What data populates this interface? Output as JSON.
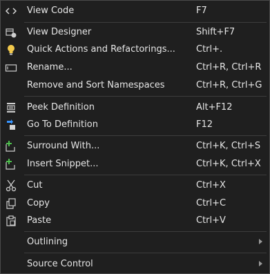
{
  "menu": {
    "view_code": {
      "label": "View Code",
      "shortcut": "F7",
      "icon": "code-icon"
    },
    "view_designer": {
      "label": "View Designer",
      "shortcut": "Shift+F7",
      "icon": "designer-icon"
    },
    "quick_actions": {
      "label": "Quick Actions and Refactorings...",
      "shortcut": "Ctrl+.",
      "icon": "lightbulb-icon"
    },
    "rename": {
      "label": "Rename...",
      "shortcut": "Ctrl+R, Ctrl+R",
      "icon": "rename-icon"
    },
    "remove_sort": {
      "label": "Remove and Sort Namespaces",
      "shortcut": "Ctrl+R, Ctrl+G"
    },
    "peek_definition": {
      "label": "Peek Definition",
      "shortcut": "Alt+F12",
      "icon": "peek-definition-icon"
    },
    "go_to_definition": {
      "label": "Go To Definition",
      "shortcut": "F12",
      "icon": "go-to-definition-icon"
    },
    "surround_with": {
      "label": "Surround With...",
      "shortcut": "Ctrl+K, Ctrl+S",
      "icon": "surround-with-icon"
    },
    "insert_snippet": {
      "label": "Insert Snippet...",
      "shortcut": "Ctrl+K, Ctrl+X",
      "icon": "insert-snippet-icon"
    },
    "cut": {
      "label": "Cut",
      "shortcut": "Ctrl+X",
      "icon": "scissors-icon"
    },
    "copy": {
      "label": "Copy",
      "shortcut": "Ctrl+C",
      "icon": "copy-icon"
    },
    "paste": {
      "label": "Paste",
      "shortcut": "Ctrl+V",
      "icon": "paste-icon"
    },
    "outlining": {
      "label": "Outlining",
      "icon": "chevron-right-icon"
    },
    "source_control": {
      "label": "Source Control",
      "icon": "chevron-right-icon"
    }
  },
  "colors": {
    "background": "#1f1f1f",
    "text": "#e6e6e6",
    "separator": "#3d3d3d",
    "accent_blue": "#3794ff",
    "lightbulb": "#f2c94c",
    "snippet_green": "#4ec04e"
  }
}
